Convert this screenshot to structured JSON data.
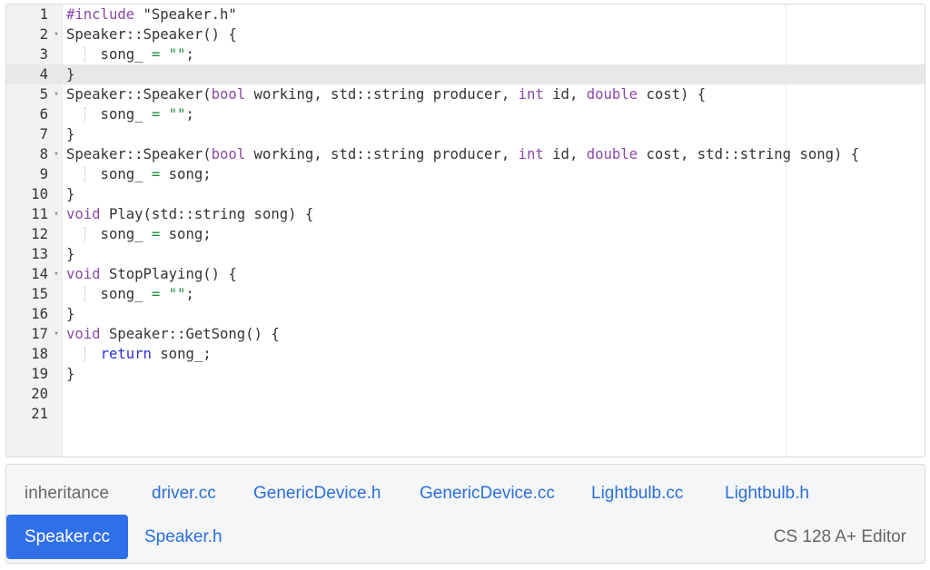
{
  "editor": {
    "active_line": 4,
    "lines": [
      {
        "n": "1",
        "fold": false,
        "guide": false,
        "tokens": [
          {
            "t": "#include",
            "c": "pp"
          },
          {
            "t": " \"Speaker.h\"",
            "c": "plain"
          }
        ]
      },
      {
        "n": "2",
        "fold": true,
        "guide": false,
        "tokens": [
          {
            "t": "Speaker::Speaker() {",
            "c": "plain"
          }
        ]
      },
      {
        "n": "3",
        "fold": false,
        "guide": true,
        "tokens": [
          {
            "t": "    song_ ",
            "c": "plain"
          },
          {
            "t": "=",
            "c": "op"
          },
          {
            "t": " ",
            "c": "plain"
          },
          {
            "t": "\"\"",
            "c": "str"
          },
          {
            "t": ";",
            "c": "plain"
          }
        ]
      },
      {
        "n": "4",
        "fold": false,
        "guide": false,
        "tokens": [
          {
            "t": "}",
            "c": "plain"
          }
        ]
      },
      {
        "n": "5",
        "fold": true,
        "guide": false,
        "tokens": [
          {
            "t": "Speaker::Speaker(",
            "c": "plain"
          },
          {
            "t": "bool",
            "c": "kw"
          },
          {
            "t": " working, std::string producer, ",
            "c": "plain"
          },
          {
            "t": "int",
            "c": "kw"
          },
          {
            "t": " id, ",
            "c": "plain"
          },
          {
            "t": "double",
            "c": "kw"
          },
          {
            "t": " cost) {",
            "c": "plain"
          }
        ]
      },
      {
        "n": "6",
        "fold": false,
        "guide": true,
        "tokens": [
          {
            "t": "    song_ ",
            "c": "plain"
          },
          {
            "t": "=",
            "c": "op"
          },
          {
            "t": " ",
            "c": "plain"
          },
          {
            "t": "\"\"",
            "c": "str"
          },
          {
            "t": ";",
            "c": "plain"
          }
        ]
      },
      {
        "n": "7",
        "fold": false,
        "guide": false,
        "tokens": [
          {
            "t": "}",
            "c": "plain"
          }
        ]
      },
      {
        "n": "8",
        "fold": true,
        "guide": false,
        "tokens": [
          {
            "t": "Speaker::Speaker(",
            "c": "plain"
          },
          {
            "t": "bool",
            "c": "kw"
          },
          {
            "t": " working, std::string producer, ",
            "c": "plain"
          },
          {
            "t": "int",
            "c": "kw"
          },
          {
            "t": " id, ",
            "c": "plain"
          },
          {
            "t": "double",
            "c": "kw"
          },
          {
            "t": " cost, std::string song) {",
            "c": "plain"
          }
        ]
      },
      {
        "n": "9",
        "fold": false,
        "guide": true,
        "tokens": [
          {
            "t": "    song_ ",
            "c": "plain"
          },
          {
            "t": "=",
            "c": "op"
          },
          {
            "t": " song;",
            "c": "plain"
          }
        ]
      },
      {
        "n": "10",
        "fold": false,
        "guide": false,
        "tokens": [
          {
            "t": "}",
            "c": "plain"
          }
        ]
      },
      {
        "n": "11",
        "fold": true,
        "guide": false,
        "tokens": [
          {
            "t": "void",
            "c": "kw"
          },
          {
            "t": " Play(std::string song) {",
            "c": "plain"
          }
        ]
      },
      {
        "n": "12",
        "fold": false,
        "guide": true,
        "tokens": [
          {
            "t": "    song_ ",
            "c": "plain"
          },
          {
            "t": "=",
            "c": "op"
          },
          {
            "t": " song;",
            "c": "plain"
          }
        ]
      },
      {
        "n": "13",
        "fold": false,
        "guide": false,
        "tokens": [
          {
            "t": "}",
            "c": "plain"
          }
        ]
      },
      {
        "n": "14",
        "fold": true,
        "guide": false,
        "tokens": [
          {
            "t": "void",
            "c": "kw"
          },
          {
            "t": " StopPlaying() {",
            "c": "plain"
          }
        ]
      },
      {
        "n": "15",
        "fold": false,
        "guide": true,
        "tokens": [
          {
            "t": "    song_ ",
            "c": "plain"
          },
          {
            "t": "=",
            "c": "op"
          },
          {
            "t": " ",
            "c": "plain"
          },
          {
            "t": "\"\"",
            "c": "str"
          },
          {
            "t": ";",
            "c": "plain"
          }
        ]
      },
      {
        "n": "16",
        "fold": false,
        "guide": false,
        "tokens": [
          {
            "t": "}",
            "c": "plain"
          }
        ]
      },
      {
        "n": "17",
        "fold": true,
        "guide": false,
        "tokens": [
          {
            "t": "void",
            "c": "kw"
          },
          {
            "t": " Speaker::GetSong() {",
            "c": "plain"
          }
        ]
      },
      {
        "n": "18",
        "fold": false,
        "guide": true,
        "tokens": [
          {
            "t": "    ",
            "c": "plain"
          },
          {
            "t": "return",
            "c": "kw-ret"
          },
          {
            "t": " song_;",
            "c": "plain"
          }
        ]
      },
      {
        "n": "19",
        "fold": false,
        "guide": false,
        "tokens": [
          {
            "t": "}",
            "c": "plain"
          }
        ]
      },
      {
        "n": "20",
        "fold": false,
        "guide": false,
        "tokens": []
      },
      {
        "n": "21",
        "fold": false,
        "guide": false,
        "tokens": []
      }
    ]
  },
  "tabs": {
    "label": "inheritance",
    "row1": [
      "driver.cc",
      "GenericDevice.h",
      "GenericDevice.cc",
      "Lightbulb.cc",
      "Lightbulb.h"
    ],
    "active": "Speaker.cc",
    "row2_others": [
      "Speaker.h"
    ],
    "brand": "CS 128 A+ Editor"
  },
  "colors": {
    "accent": "#2f6fea",
    "link": "#2a6fdb",
    "keyword": "#8a4aa8",
    "string": "#1f8a3a",
    "return_keyword": "#2e2ed0"
  },
  "icons": {
    "fold_marker": "fold-arrow-icon"
  }
}
